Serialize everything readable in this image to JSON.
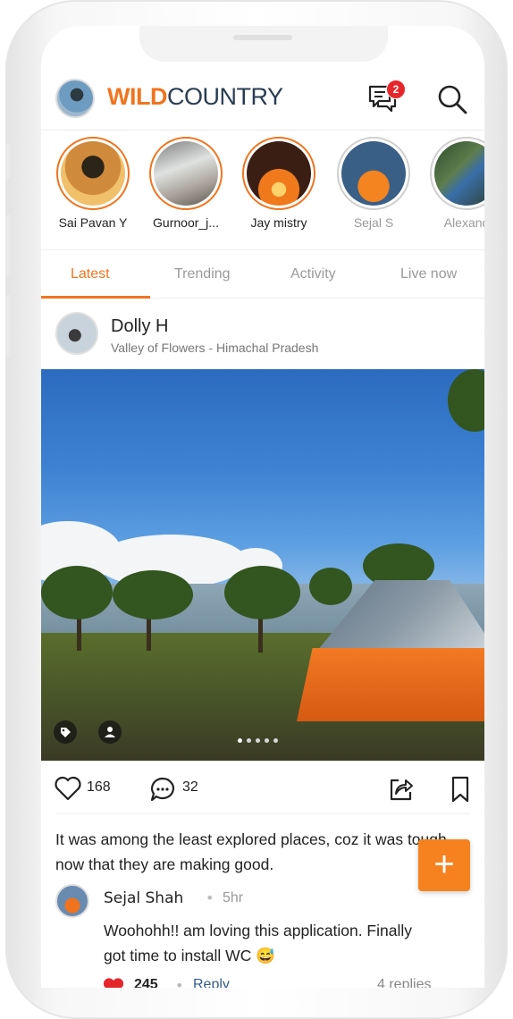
{
  "header": {
    "logo_wild": "WILD",
    "logo_country": "COUNTRY",
    "message_badge": "2",
    "icons": [
      "profile-avatar",
      "chat-icon",
      "search-icon"
    ]
  },
  "stories": [
    {
      "name": "Sai Pavan Y",
      "seen": false
    },
    {
      "name": "Gurnoor_j...",
      "seen": false
    },
    {
      "name": "Jay mistry",
      "seen": false
    },
    {
      "name": "Sejal S",
      "seen": true
    },
    {
      "name": "Alexand",
      "seen": true
    }
  ],
  "tabs": [
    {
      "label": "Latest",
      "active": true
    },
    {
      "label": "Trending",
      "active": false
    },
    {
      "label": "Activity",
      "active": false
    },
    {
      "label": "Live now",
      "active": false
    }
  ],
  "post": {
    "author": "Dolly H",
    "location": "Valley of Flowers - Himachal Pradesh",
    "likes": "168",
    "comments": "32",
    "caption": "It was among the least explored places, coz it was tough, now that they are making good.",
    "image_count": 5,
    "active_image": 1
  },
  "comment": {
    "author": "Sejal Shah",
    "time": "5hr",
    "text": "Woohohh!! am loving this application. Finally got time to install WC 😅",
    "likes": "245",
    "reply_label": "Reply",
    "replies": "4 replies"
  },
  "fab": {
    "label": "+"
  },
  "colors": {
    "accent": "#f0751f",
    "logo_dark": "#2a3d52",
    "badge": "#e5262a"
  }
}
